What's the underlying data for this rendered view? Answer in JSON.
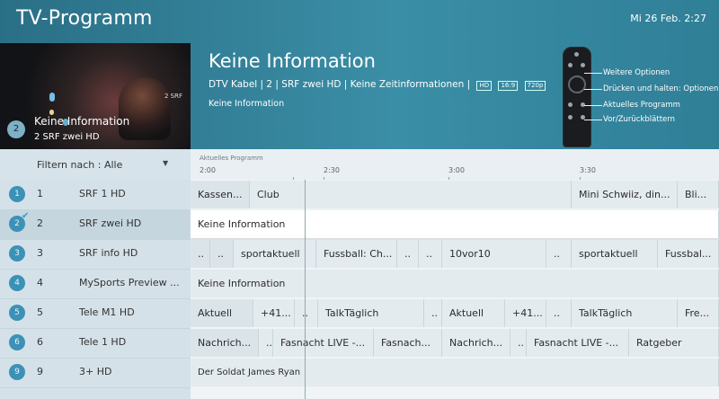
{
  "header": {
    "title": "TV-Programm",
    "clock": "Mi 26 Feb.  2:27"
  },
  "preview": {
    "badge": "2",
    "title": "Keine Information",
    "subtitle": "2  SRF zwei HD",
    "logo": "2 SRF"
  },
  "info": {
    "title": "Keine Information",
    "meta": "DTV Kabel | 2 | SRF zwei HD | Keine Zeitinformationen |",
    "tags": [
      "HD",
      "16:9",
      "720p"
    ],
    "description": "Keine Information"
  },
  "remote_hints": [
    {
      "label": "Weitere Optionen"
    },
    {
      "label": "Drücken und halten: Optionen"
    },
    {
      "label": "Aktuelles Programm"
    },
    {
      "label": "Vor/Zurückblättern"
    }
  ],
  "filter": {
    "label": "Filtern nach : Alle"
  },
  "timeline": {
    "now_label": "Aktuelles Programm",
    "times": [
      "2:00",
      "2:30",
      "3:00",
      "3:30"
    ]
  },
  "channels": [
    {
      "badge": "1",
      "number": "1",
      "name": "SRF 1 HD",
      "selected": false
    },
    {
      "badge": "2",
      "number": "2",
      "name": "SRF zwei HD",
      "selected": true
    },
    {
      "badge": "3",
      "number": "3",
      "name": "SRF info HD",
      "selected": false
    },
    {
      "badge": "4",
      "number": "4",
      "name": "MySports Preview ...",
      "selected": false
    },
    {
      "badge": "5",
      "number": "5",
      "name": "Tele M1 HD",
      "selected": false
    },
    {
      "badge": "6",
      "number": "6",
      "name": "Tele 1 HD",
      "selected": false
    },
    {
      "badge": "9",
      "number": "9",
      "name": "3+ HD",
      "selected": false
    }
  ],
  "programs": [
    [
      {
        "title": "Kassen..."
      },
      {
        "title": "Club"
      },
      {
        "title": "Mini Schwiiz, din..."
      },
      {
        "title": "Bli..."
      }
    ],
    [
      {
        "title": "Keine Information"
      }
    ],
    [
      {
        "title": ".."
      },
      {
        "title": ".."
      },
      {
        "title": "sportaktuell"
      },
      {
        "title": "Fussball: Ch..."
      },
      {
        "title": ".."
      },
      {
        "title": ".."
      },
      {
        "title": "10vor10"
      },
      {
        "title": ".."
      },
      {
        "title": "sportaktuell"
      },
      {
        "title": "Fussbal..."
      }
    ],
    [
      {
        "title": "Keine Information"
      }
    ],
    [
      {
        "title": "Aktuell"
      },
      {
        "title": "+41..."
      },
      {
        "title": ".."
      },
      {
        "title": "TalkTäglich"
      },
      {
        "title": ".."
      },
      {
        "title": "Aktuell"
      },
      {
        "title": "+41..."
      },
      {
        "title": ".."
      },
      {
        "title": "TalkTäglich"
      },
      {
        "title": "Fre..."
      }
    ],
    [
      {
        "title": "Nachrich..."
      },
      {
        "title": ".."
      },
      {
        "title": "Fasnacht LIVE -..."
      },
      {
        "title": "Fasnach..."
      },
      {
        "title": "Nachrich..."
      },
      {
        "title": ".."
      },
      {
        "title": "Fasnacht LIVE -..."
      },
      {
        "title": "Ratgeber"
      }
    ],
    [
      {
        "title": "Der Soldat James Ryan"
      }
    ]
  ]
}
